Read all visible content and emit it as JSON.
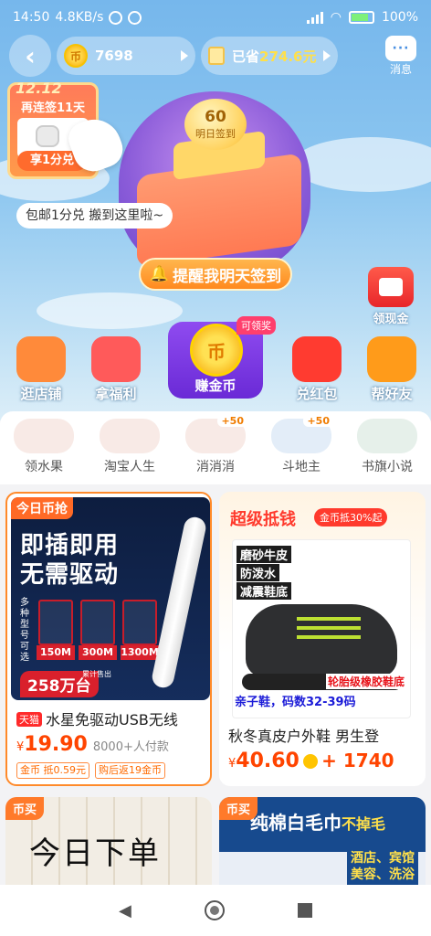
{
  "status": {
    "time": "14:50",
    "speed": "4.8KB/s",
    "battery": "100%"
  },
  "header": {
    "back_icon": "chevron-left-icon",
    "coins": "7698",
    "coin_glyph": "币",
    "saved_prefix": "已省",
    "saved_amount": "274.6元",
    "messages_label": "消息",
    "messages_glyph": "···"
  },
  "promo": {
    "date": "12.12",
    "streak_text": "再连签11天",
    "redeem_btn": "享1分兑",
    "tip": "包邮1分兑 搬到这里啦~",
    "checkin_coins": "60",
    "checkin_label": "明日签到",
    "remind_btn": "提醒我明天签到",
    "red_packet_label": "领现金"
  },
  "actions": [
    {
      "label": "逛店铺",
      "icon": "shop-icon",
      "color": "#ff8a3a"
    },
    {
      "label": "拿福利",
      "icon": "gift-icon",
      "color": "#ff5a5a"
    },
    {
      "label": "兑红包",
      "icon": "red-envelope-icon",
      "color": "#ff3b30"
    },
    {
      "label": "帮好友",
      "icon": "coin-icon",
      "color": "#ff9b1a"
    }
  ],
  "earn": {
    "label": "赚金币",
    "badge": "可领奖",
    "glyph": "币"
  },
  "games": [
    {
      "label": "领水果",
      "plus": ""
    },
    {
      "label": "淘宝人生",
      "plus": ""
    },
    {
      "label": "消消消",
      "plus": "+50"
    },
    {
      "label": "斗地主",
      "plus": "+50"
    },
    {
      "label": "书旗小说",
      "plus": ""
    }
  ],
  "products": {
    "p1": {
      "corner": "今日币抢",
      "ad_line1": "即插即用",
      "ad_line2": "无需驱动",
      "ad_side": "多种型号可选",
      "models": [
        "150M",
        "300M",
        "1300M"
      ],
      "ad_price": "258万台",
      "ad_sub": "累计售出",
      "shop_tag": "天猫",
      "title": "水星免驱动USB无线",
      "price_symbol": "¥",
      "price": "19.90",
      "sold": "8000+人付款",
      "badge1": "金币 抵0.59元",
      "badge2": "购后返19金币"
    },
    "p2": {
      "header": "超级抵钱",
      "pill": "金币抵30%起",
      "feature1": "磨砂牛皮",
      "feature2": "防泼水",
      "feature3": "减震鞋底",
      "feature4": "轮胎级橡胶鞋底",
      "feature5": "亲子鞋，码数32-39码",
      "title": "秋冬真皮户外鞋 男生登",
      "price_symbol": "¥",
      "price": "40.60",
      "coins": "+ 1740"
    },
    "p3": {
      "corner": "币买",
      "handwriting": "今日下单"
    },
    "p4": {
      "corner": "币买",
      "ad_title": "纯棉白毛巾",
      "ad_title2": "不掉毛",
      "ad_hot": "酒店、宾馆\n美容、洗浴"
    }
  },
  "nav": {
    "back": "◀",
    "home": "home-icon",
    "recent": "recent-apps-icon"
  }
}
